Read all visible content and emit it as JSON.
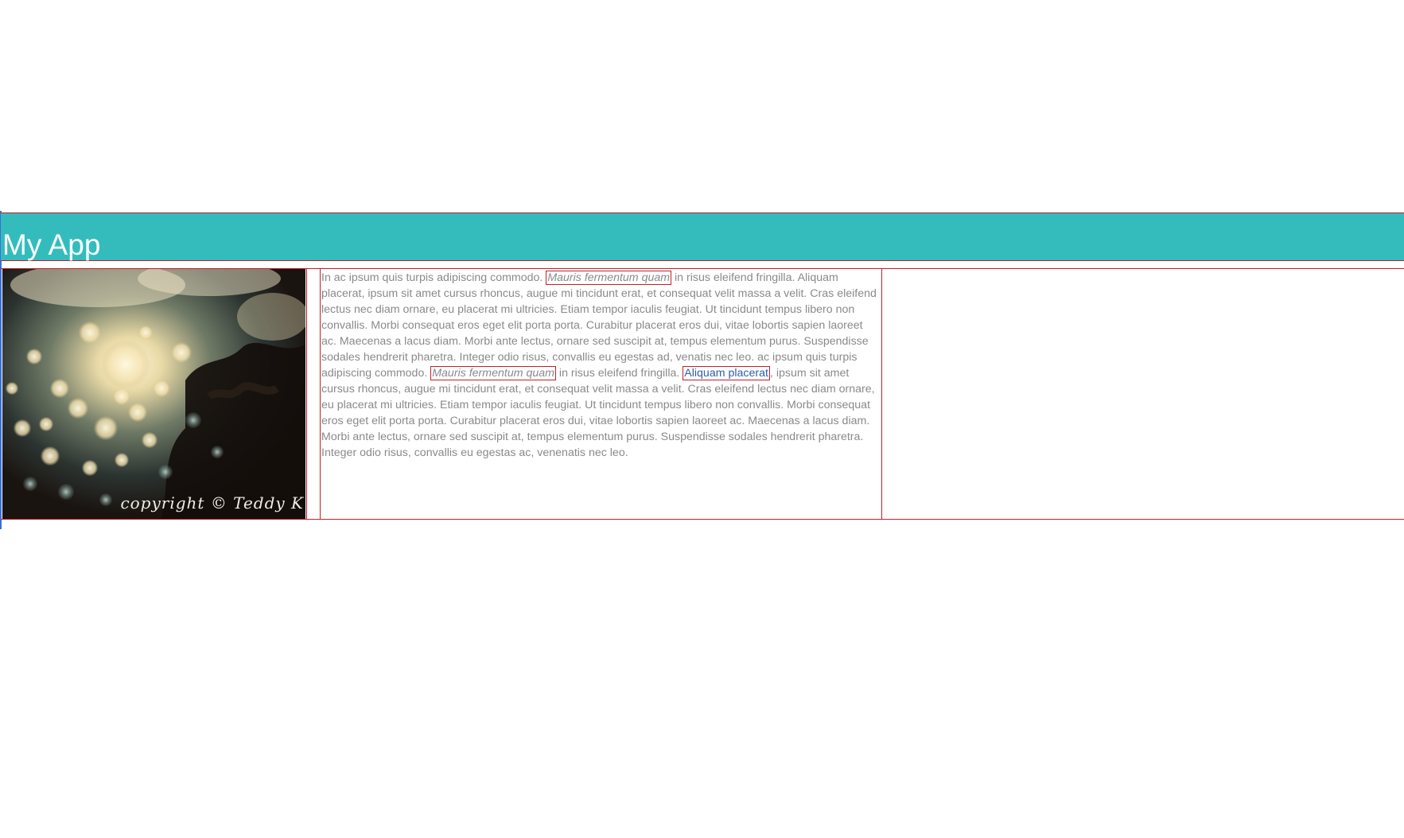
{
  "app": {
    "title": "My App"
  },
  "photo": {
    "credit": "copyright © Teddy K"
  },
  "article": {
    "seg1": "In ac ipsum quis turpis adipiscing commodo. ",
    "em1": "Mauris fermentum quam",
    "seg2": " in risus eleifend fringilla. Aliquam placerat, ipsum sit amet cursus rhoncus, augue mi tincidunt erat, et consequat velit massa a velit. Cras eleifend lectus nec diam ornare, eu placerat mi ultricies. Etiam tempor iaculis feugiat. Ut tincidunt tempus libero non convallis. Morbi consequat eros eget elit porta porta. Curabitur placerat eros dui, vitae lobortis sapien laoreet ac. Maecenas a lacus diam. Morbi ante lectus, ornare sed suscipit at, tempus elementum purus. Suspendisse sodales hendrerit pharetra. Integer odio risus, convallis eu egestas ad, venatis nec leo. ac ipsum quis turpis adipiscing commodo. ",
    "em2": "Mauris fermentum quam",
    "seg3": " in risus eleifend fringilla. ",
    "link": "Aliquam placerat",
    "seg4": ", ipsum sit amet cursus rhoncus, augue mi tincidunt erat, et consequat velit massa a velit. Cras eleifend lectus nec diam ornare, eu placerat mi ultricies. Etiam tempor iaculis feugiat. Ut tincidunt tempus libero non convallis. Morbi consequat eros eget elit porta porta. Curabitur placerat eros dui, vitae lobortis sapien laoreet ac. Maecenas a lacus diam. Morbi ante lectus, ornare sed suscipit at, tempus elementum purus. Suspendisse sodales hendrerit pharetra. Integer odio risus, convallis eu egestas ac, venenatis nec leo."
  },
  "colors": {
    "header_bg": "#34bcbd",
    "border": "#c0202a",
    "body_text": "#8a8a8a",
    "link": "#2d5fa8"
  }
}
